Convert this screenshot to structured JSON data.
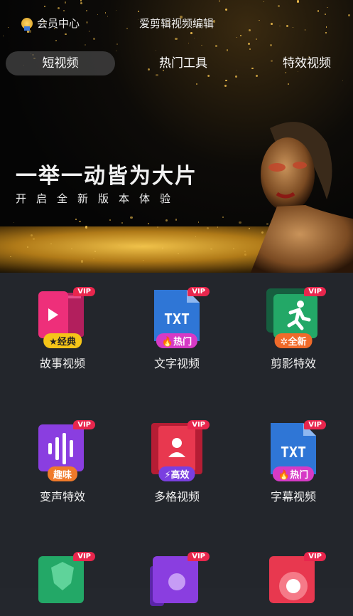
{
  "header": {
    "member_center": "会员中心",
    "app_title": "爱剪辑视频编辑"
  },
  "tabs": [
    {
      "label": "短视频",
      "active": true
    },
    {
      "label": "热门工具",
      "active": false
    },
    {
      "label": "特效视频",
      "active": false
    }
  ],
  "banner": {
    "slogan": "一举一动皆为大片",
    "subtitle": "开启全新版本体验"
  },
  "vip_tag": "VIP",
  "tools": [
    {
      "label": "故事视频",
      "badge": "★经典",
      "badge_color": "#f5c518",
      "icon": "play-film-icon",
      "color": "#ee2f7a"
    },
    {
      "label": "文字视频",
      "badge": "🔥热门",
      "badge_color": "#d63ac6",
      "icon": "txt-document-icon",
      "color": "#2f76d6"
    },
    {
      "label": "剪影特效",
      "badge": "✲全新",
      "badge_color": "#f06a2a",
      "icon": "running-figure-icon",
      "color": "#23a867"
    },
    {
      "label": "变声特效",
      "badge": "趣味",
      "badge_color": "#f07a2a",
      "icon": "soundwave-icon",
      "color": "#8a3ee0"
    },
    {
      "label": "多格视频",
      "badge": "⚡高效",
      "badge_color": "#7a3fe0",
      "icon": "person-film-icon",
      "color": "#e8384f"
    },
    {
      "label": "字幕视频",
      "badge": "🔥热门",
      "badge_color": "#d63ac6",
      "icon": "txt-document-icon",
      "color": "#2f76d6"
    },
    {
      "label": "",
      "badge": "",
      "badge_color": "",
      "icon": "badge-shield-icon",
      "color": "#23a867"
    },
    {
      "label": "",
      "badge": "",
      "badge_color": "",
      "icon": "character-icon",
      "color": "#8a3ee0"
    },
    {
      "label": "",
      "badge": "",
      "badge_color": "",
      "icon": "circle-burst-icon",
      "color": "#e8384f"
    }
  ]
}
